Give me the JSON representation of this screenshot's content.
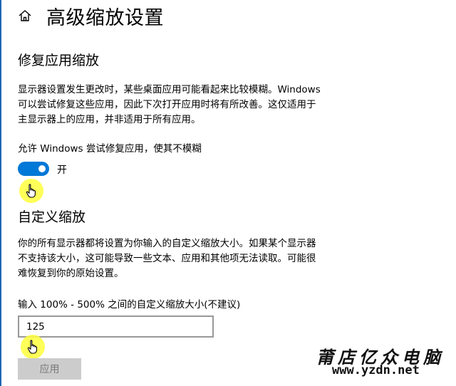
{
  "header": {
    "title": "高级缩放设置"
  },
  "fix_apps": {
    "title": "修复应用缩放",
    "description": "显示器设置发生更改时，某些桌面应用可能看起来比较模糊。Windows 可以尝试修复这些应用，因此下次打开应用时将有所改善。这仅适用于主显示器上的应用，并非适用于所有应用。",
    "toggle_label": "允许 Windows 尝试修复应用，使其不模糊",
    "toggle_state": "开",
    "toggle_on": true
  },
  "custom_scaling": {
    "title": "自定义缩放",
    "description": "你的所有显示器都将设置为你输入的自定义缩放大小。如果某个显示器不支持该大小，这可能导致一些文本、应用和其他项无法读取。可能很难恢复到你的原始设置。",
    "input_label": "输入 100% - 500% 之间的自定义缩放大小(不建议)",
    "input_value": "125",
    "apply_label": "应用"
  },
  "watermark": {
    "name": "莆店亿众电脑",
    "url": "www.yzdn.net"
  },
  "colors": {
    "accent": "#0078d7",
    "cursor_highlight": "#ffff3c",
    "disabled_button": "#cccccc"
  },
  "icons": {
    "home": "home-icon",
    "cursor": "hand-pointer-icon"
  }
}
